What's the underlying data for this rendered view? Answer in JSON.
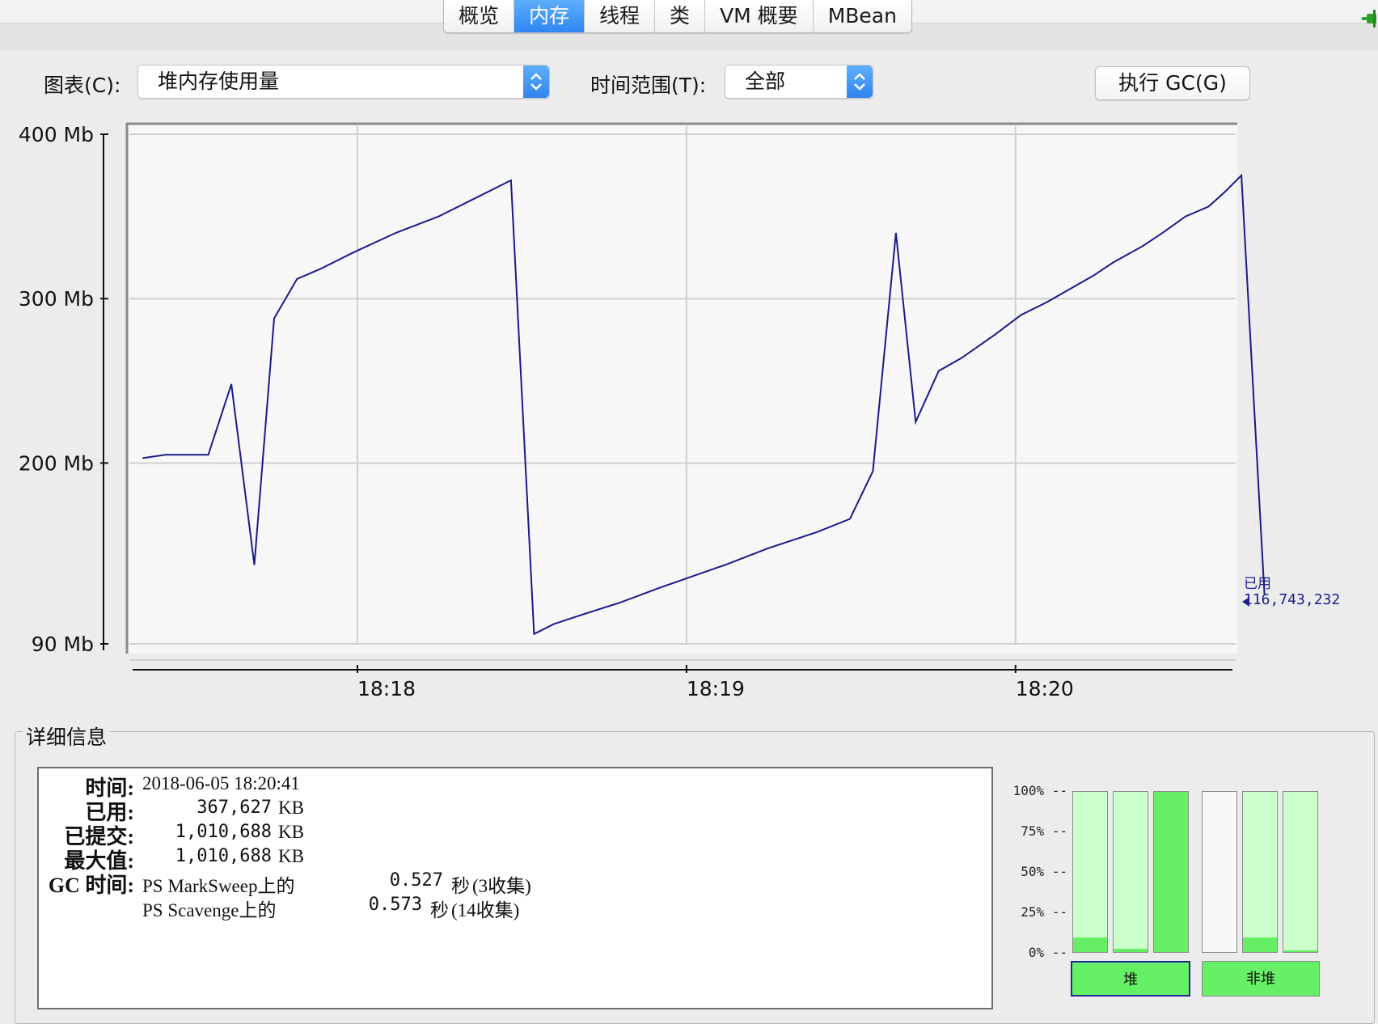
{
  "tabs": [
    {
      "label": "概览",
      "active": false
    },
    {
      "label": "内存",
      "active": true
    },
    {
      "label": "线程",
      "active": false
    },
    {
      "label": "类",
      "active": false
    },
    {
      "label": "VM 概要",
      "active": false
    },
    {
      "label": "MBean",
      "active": false
    }
  ],
  "controls": {
    "chart_label": "图表(C):",
    "chart_value": "堆内存使用量",
    "range_label": "时间范围(T):",
    "range_value": "全部",
    "gc_button": "执行 GC(G)"
  },
  "chart_data": {
    "type": "line",
    "title": "",
    "y_ticks": [
      "400 Mb",
      "300 Mb",
      "200 Mb",
      "90 Mb"
    ],
    "y_tick_values": [
      400,
      300,
      200,
      90
    ],
    "x_ticks": [
      "18:18",
      "18:19",
      "18:20"
    ],
    "x_tick_values": [
      18.1833,
      19.1833,
      20.1833
    ],
    "ylim": [
      90,
      400
    ],
    "xlim": [
      17.5,
      20.85
    ],
    "grid": true,
    "series": [
      {
        "name": "已用",
        "color": "#1a1a8c",
        "points": [
          [
            17.53,
            203
          ],
          [
            17.6,
            205
          ],
          [
            17.73,
            205
          ],
          [
            17.8,
            248
          ],
          [
            17.87,
            138
          ],
          [
            17.93,
            288
          ],
          [
            18.0,
            312
          ],
          [
            18.07,
            318
          ],
          [
            18.17,
            328
          ],
          [
            18.3,
            340
          ],
          [
            18.43,
            350
          ],
          [
            18.53,
            360
          ],
          [
            18.65,
            372
          ],
          [
            18.72,
            96
          ],
          [
            18.78,
            102
          ],
          [
            18.87,
            108
          ],
          [
            18.98,
            115
          ],
          [
            19.1,
            124
          ],
          [
            19.2,
            131
          ],
          [
            19.3,
            138
          ],
          [
            19.43,
            148
          ],
          [
            19.58,
            158
          ],
          [
            19.68,
            166
          ],
          [
            19.75,
            195
          ],
          [
            19.82,
            340
          ],
          [
            19.88,
            225
          ],
          [
            19.95,
            256
          ],
          [
            20.02,
            264
          ],
          [
            20.12,
            278
          ],
          [
            20.2,
            290
          ],
          [
            20.28,
            298
          ],
          [
            20.35,
            306
          ],
          [
            20.42,
            314
          ],
          [
            20.48,
            322
          ],
          [
            20.57,
            332
          ],
          [
            20.63,
            340
          ],
          [
            20.7,
            350
          ],
          [
            20.77,
            356
          ],
          [
            20.82,
            365
          ],
          [
            20.87,
            375
          ],
          [
            20.94,
            120
          ]
        ]
      }
    ],
    "legend_label": "已用",
    "legend_value": "116,743,232"
  },
  "details": {
    "title": "详细信息",
    "time_label": "时间:",
    "time_value": "2018-06-05 18:20:41",
    "used_label": "已用:",
    "used_value": "367,627",
    "committed_label": "已提交:",
    "committed_value": "1,010,688",
    "max_label": "最大值:",
    "max_value": "1,010,688",
    "unit": "KB",
    "gc_label": "GC 时间:",
    "gc_rows": [
      {
        "name": "PS MarkSweep上的",
        "time": "0.527",
        "unit": "秒",
        "note": "(3收集)"
      },
      {
        "name": "PS Scavenge上的",
        "time": "0.573",
        "unit": "秒",
        "note": "(14收集)"
      }
    ]
  },
  "gauges": {
    "ticks": [
      "100% --",
      "75% --",
      "50% --",
      "25% --",
      "0% --"
    ],
    "bars": [
      {
        "fill": 0.09,
        "empty": false
      },
      {
        "fill": 0.02,
        "empty": false
      },
      {
        "fill": 1.0,
        "empty": false
      },
      {
        "fill": 0.0,
        "empty": true
      },
      {
        "fill": 0.09,
        "empty": false
      },
      {
        "fill": 0.01,
        "empty": false
      }
    ],
    "heap_label": "堆",
    "nonheap_label": "非堆",
    "fill_color": "#66ee66"
  }
}
